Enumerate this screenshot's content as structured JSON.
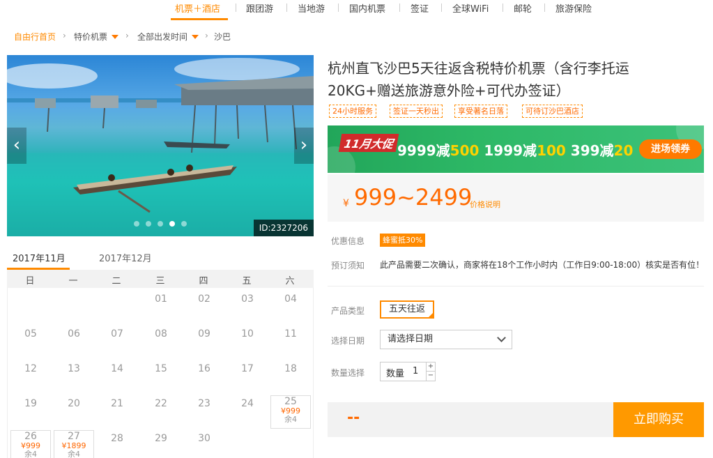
{
  "nav": {
    "items": [
      {
        "label": "机票＋酒店",
        "active": true
      },
      {
        "label": "跟团游"
      },
      {
        "label": "当地游"
      },
      {
        "label": "国内机票"
      },
      {
        "label": "签证"
      },
      {
        "label": "全球WiFi"
      },
      {
        "label": "邮轮"
      },
      {
        "label": "旅游保险"
      }
    ]
  },
  "breadcrumb": {
    "home": "自由行首页",
    "cat1": "特价机票",
    "cat2": "全部出发时间",
    "current": "沙巴"
  },
  "hero": {
    "image_id": "ID:2327206",
    "prev_glyph": "‹",
    "next_glyph": "›"
  },
  "calendar": {
    "tabs": [
      "2017年11月",
      "2017年12月"
    ],
    "weekdays": [
      "日",
      "一",
      "二",
      "三",
      "四",
      "五",
      "六"
    ],
    "days": [
      "01",
      "02",
      "03",
      "04",
      "05",
      "06",
      "07",
      "08",
      "09",
      "10",
      "11",
      "12",
      "13",
      "14",
      "15",
      "16",
      "17",
      "18",
      "19",
      "20",
      "21",
      "22",
      "23",
      "24",
      "25",
      "26",
      "27",
      "28",
      "29",
      "30"
    ],
    "available": {
      "d25": {
        "price": "¥999",
        "stock": "余4"
      },
      "d26": {
        "price": "¥999",
        "stock": "余4"
      },
      "d27": {
        "price": "¥1899",
        "stock": "余4"
      }
    }
  },
  "product": {
    "title": "杭州直飞沙巴5天往返含税特价机票（含行李托运20KG+赠送旅游意外险+可代办签证）",
    "tags": [
      "24小时服务",
      "签证一天秒出",
      "享受著名日落",
      "可待订沙巴酒店"
    ]
  },
  "promo": {
    "badge": "11月大促",
    "offers": [
      {
        "spend": "9999减",
        "off": "500"
      },
      {
        "spend": "1999减",
        "off": "100"
      },
      {
        "spend": "399减",
        "off": "20"
      }
    ],
    "cta": "进场领券"
  },
  "price": {
    "currency": "¥",
    "range": "999~2499",
    "note": "价格说明"
  },
  "info": {
    "discount_label": "优惠信息",
    "discount_tag": "蜂蜜抵30%",
    "notice_label": "预订须知",
    "notice_text": "此产品需要二次确认，商家将在18个工作小时内（工作日9:00-18:00）核实是否有位！",
    "type_label": "产品类型",
    "type_value": "五天往返",
    "date_label": "选择日期",
    "date_placeholder": "请选择日期",
    "qty_label": "数量选择",
    "qty_inner_label": "数量",
    "qty_value": "1",
    "plus": "+",
    "minus": "−"
  },
  "buy": {
    "total": "--",
    "button": "立即购买"
  },
  "colors": {
    "accent": "#ff8a00",
    "price": "#ff6a00",
    "promo_green": "#2db866"
  }
}
